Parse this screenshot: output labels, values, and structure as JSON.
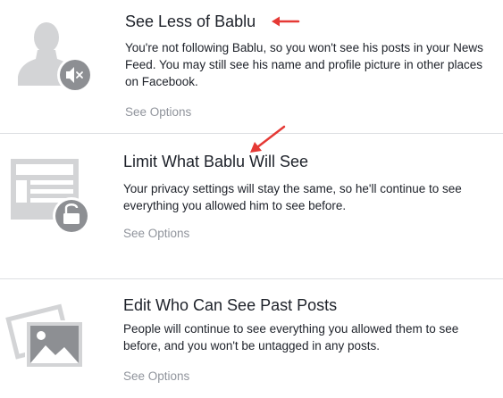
{
  "options": [
    {
      "title": "See Less of Bablu",
      "description": "You're not following Bablu, so you won't see his posts in your News Feed. You may still see his name and profile picture in other places on Facebook.",
      "action_label": "See Options",
      "icon": "person-muted-icon"
    },
    {
      "title": "Limit What Bablu Will See",
      "description": "Your privacy settings will stay the same, so he'll continue to see everything you allowed him to see before.",
      "action_label": "See Options",
      "icon": "profile-lock-icon"
    },
    {
      "title": "Edit Who Can See Past Posts",
      "description": "People will continue to see everything you allowed them to see before, and you won't be untagged in any posts.",
      "action_label": "See Options",
      "icon": "photos-icon"
    }
  ],
  "colors": {
    "annotation_arrow": "#e53935",
    "icon_gray": "#d3d4d6",
    "icon_badge": "#8d8f93",
    "link_gray": "#90949c"
  }
}
